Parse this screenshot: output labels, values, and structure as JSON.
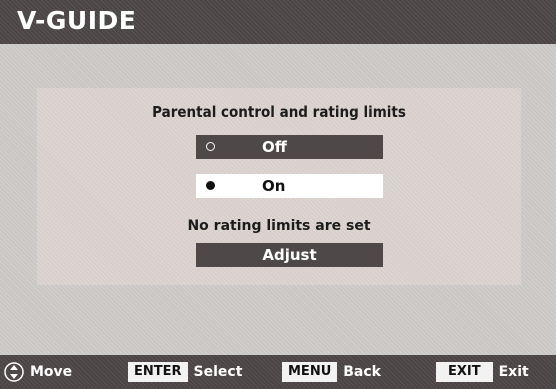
{
  "title": "V-GUIDE",
  "menu": {
    "heading": "Parental control and rating limits",
    "options": [
      {
        "label": "Off",
        "selected": false
      },
      {
        "label": "On",
        "selected": true
      }
    ],
    "status": "No rating limits are set",
    "adjust_label": "Adjust"
  },
  "footer": {
    "move_label": "Move",
    "enter_key": "ENTER",
    "enter_label": "Select",
    "menu_key": "MENU",
    "menu_label": "Back",
    "exit_key": "EXIT",
    "exit_label": "Exit"
  },
  "icons": {
    "move": "navigation-arrows-icon",
    "radio_off": "radio-unselected-icon",
    "radio_on": "radio-selected-icon"
  },
  "colors": {
    "bar": "#4b4444",
    "background": "#c9c6c4",
    "panel": "#d8cfcc",
    "highlight": "#ffffff",
    "option_dark": "#4e4848"
  }
}
